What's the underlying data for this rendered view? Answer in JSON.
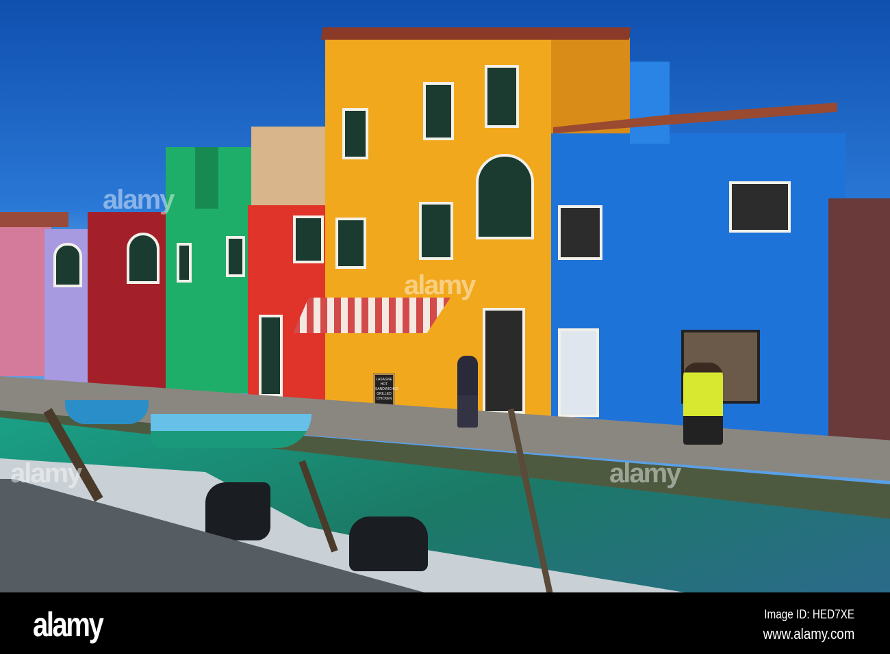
{
  "watermark": {
    "text": "alamy"
  },
  "shop_sign": {
    "lines": [
      "LASAGNE",
      "HOT",
      "SANDWICHES",
      "GRILLED",
      "CHICKEN"
    ]
  },
  "footer": {
    "logo": "alamy",
    "image_id": "Image ID: HED7XE",
    "url": "www.alamy.com"
  },
  "colors": {
    "sky": "#1f6ad0",
    "yellow_house": "#f2a81d",
    "blue_house": "#1e73d9",
    "green_house": "#1fae6a",
    "red_house": "#e0332a",
    "water": "#1f8a74"
  }
}
